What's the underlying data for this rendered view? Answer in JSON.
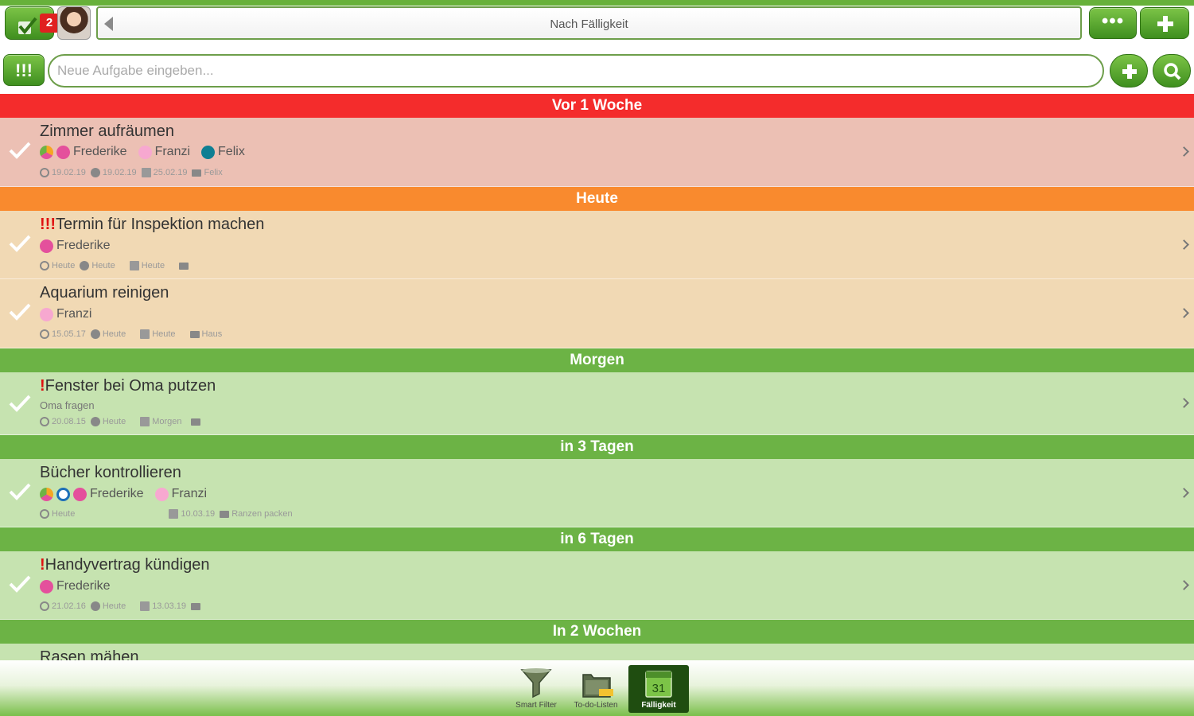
{
  "header": {
    "badge_count": "2",
    "sort_label": "Nach Fälligkeit",
    "more_label": "•••"
  },
  "input": {
    "priority_label": "!!!",
    "placeholder": "Neue Aufgabe eingeben..."
  },
  "colors": {
    "overdue_header": "#f42c2c",
    "overdue_row": "#ecc0b4",
    "today_header": "#f98a2e",
    "today_row": "#f1d9b4",
    "future_header": "#6cb345",
    "future_row": "#c6e3b0",
    "frederike": "#e4509c",
    "franzi": "#f7a8d0",
    "felix": "#0e7f93"
  },
  "sections": [
    {
      "title": "Vor 1 Woche",
      "theme": "overdue",
      "tasks": [
        {
          "prio": "",
          "title": "Zimmer aufräumen",
          "people": [
            "Frederike",
            "Franzi",
            "Felix"
          ],
          "dates": [
            "19.02.19",
            "19.02.19",
            "25.02.19",
            "Felix"
          ]
        }
      ]
    },
    {
      "title": "Heute",
      "theme": "today",
      "tasks": [
        {
          "prio": "!!!",
          "title": "Termin für Inspektion machen",
          "people": [
            "Frederike"
          ],
          "dates": [
            "Heute",
            "Heute",
            "Heute",
            ""
          ]
        },
        {
          "prio": "",
          "title": "Aquarium reinigen",
          "people": [
            "Franzi"
          ],
          "dates": [
            "15.05.17",
            "Heute",
            "Heute",
            "Haus"
          ]
        }
      ]
    },
    {
      "title": "Morgen",
      "theme": "future",
      "tasks": [
        {
          "prio": "!",
          "title": "Fenster bei Oma putzen",
          "note": "Oma fragen",
          "dates": [
            "20.08.15",
            "Heute",
            "Morgen",
            ""
          ]
        }
      ]
    },
    {
      "title": "in 3 Tagen",
      "theme": "future",
      "tasks": [
        {
          "prio": "",
          "title": "Bücher kontrollieren",
          "people": [
            "Frederike",
            "Franzi"
          ],
          "dates": [
            "Heute",
            "",
            "10.03.19",
            "Ranzen packen"
          ]
        }
      ]
    },
    {
      "title": "in 6 Tagen",
      "theme": "future",
      "tasks": [
        {
          "prio": "!",
          "title": "Handyvertrag kündigen",
          "people": [
            "Frederike"
          ],
          "dates": [
            "21.02.16",
            "Heute",
            "13.03.19",
            ""
          ]
        }
      ]
    },
    {
      "title": "In 2 Wochen",
      "theme": "future",
      "tasks": [
        {
          "prio": "",
          "title": "Rasen mähen"
        }
      ]
    }
  ],
  "bottom_tabs": [
    {
      "label": "Smart Filter",
      "icon": "funnel-icon"
    },
    {
      "label": "To-do-Listen",
      "icon": "folder-pro-icon"
    },
    {
      "label": "Fälligkeit",
      "icon": "calendar-icon",
      "day": "31",
      "active": true
    }
  ]
}
